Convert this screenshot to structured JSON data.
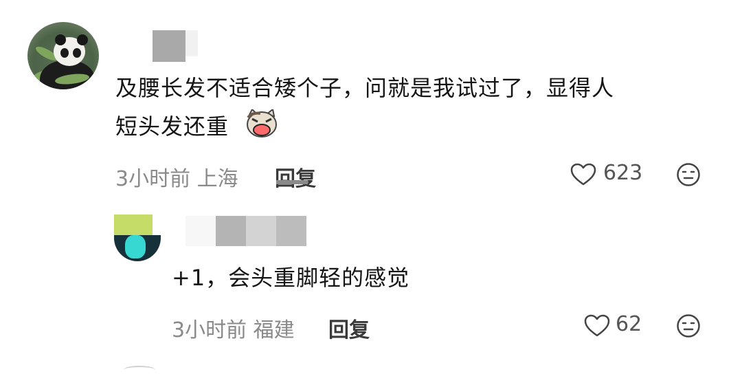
{
  "comments": [
    {
      "text_line1": "及腰长发不适合矮个子，问就是我试过了，显得人",
      "text_line2": "短头发还重",
      "time": "3小时前",
      "location": "上海",
      "reply_label": "回复",
      "likes": "623",
      "emoji": "cat-crying-emoji"
    },
    {
      "prefix": "+1",
      "text": "+1，会头重脚轻的感觉",
      "time": "3小时前",
      "location": "福建",
      "reply_label": "回复",
      "likes": "62"
    }
  ],
  "icons": {
    "like": "heart-outline-icon",
    "dislike": "meh-face-icon"
  }
}
